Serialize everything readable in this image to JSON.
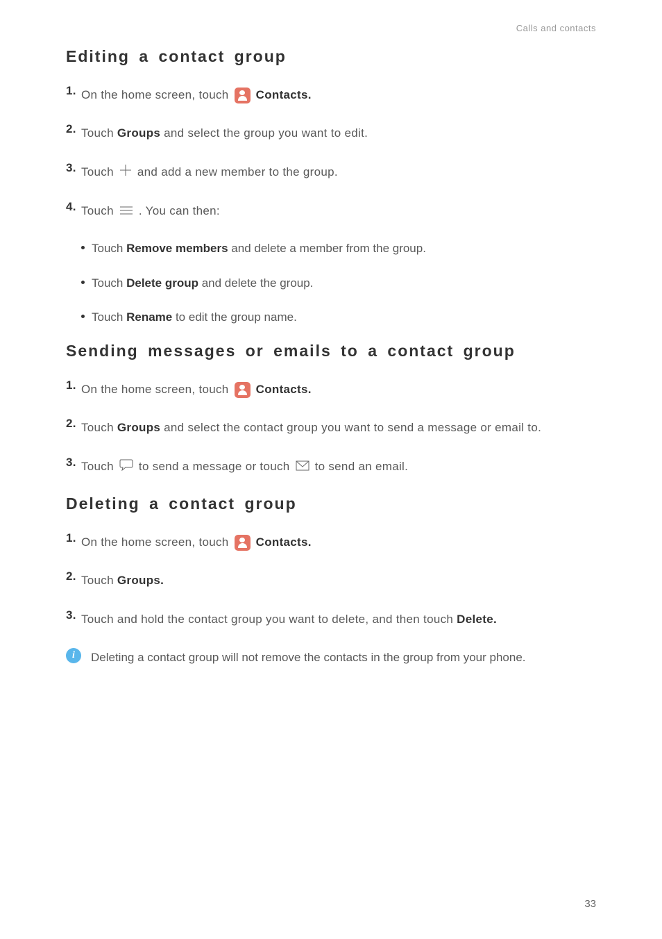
{
  "header": "Calls and contacts",
  "sections": {
    "editing": {
      "title": "Editing a contact group",
      "step1_a": "On the home screen, touch ",
      "step1_b": " Contacts",
      "step2_a": "Touch ",
      "step2_b": "Groups",
      "step2_c": " and select the group you want to edit.",
      "step3_a": "Touch ",
      "step3_b": " and add a new member to the group.",
      "step4_a": "Touch ",
      "step4_b": " . You can then:",
      "bullet1_a": "Touch ",
      "bullet1_b": "Remove members",
      "bullet1_c": " and delete a member from the group.",
      "bullet2_a": "Touch ",
      "bullet2_b": "Delete group",
      "bullet2_c": " and delete the group.",
      "bullet3_a": "Touch ",
      "bullet3_b": "Rename",
      "bullet3_c": " to edit the group name."
    },
    "sending": {
      "title": "Sending messages or emails to a contact group",
      "step1_a": "On the home screen, touch ",
      "step1_b": " Contacts",
      "step2_a": "Touch ",
      "step2_b": "Groups",
      "step2_c": " and select the contact group you want to send a message or email to.",
      "step3_a": "Touch ",
      "step3_b": " to send a message or touch ",
      "step3_c": " to send an email."
    },
    "deleting": {
      "title": "Deleting a contact group",
      "step1_a": "On the home screen, touch ",
      "step1_b": " Contacts",
      "step2_a": "Touch ",
      "step2_b": "Groups",
      "step3_a": "Touch and hold the contact group you want to delete, and then touch ",
      "step3_b": "Delete",
      "note": "Deleting a contact group will not remove the contacts in the group from your phone."
    }
  },
  "pageNumber": "33"
}
